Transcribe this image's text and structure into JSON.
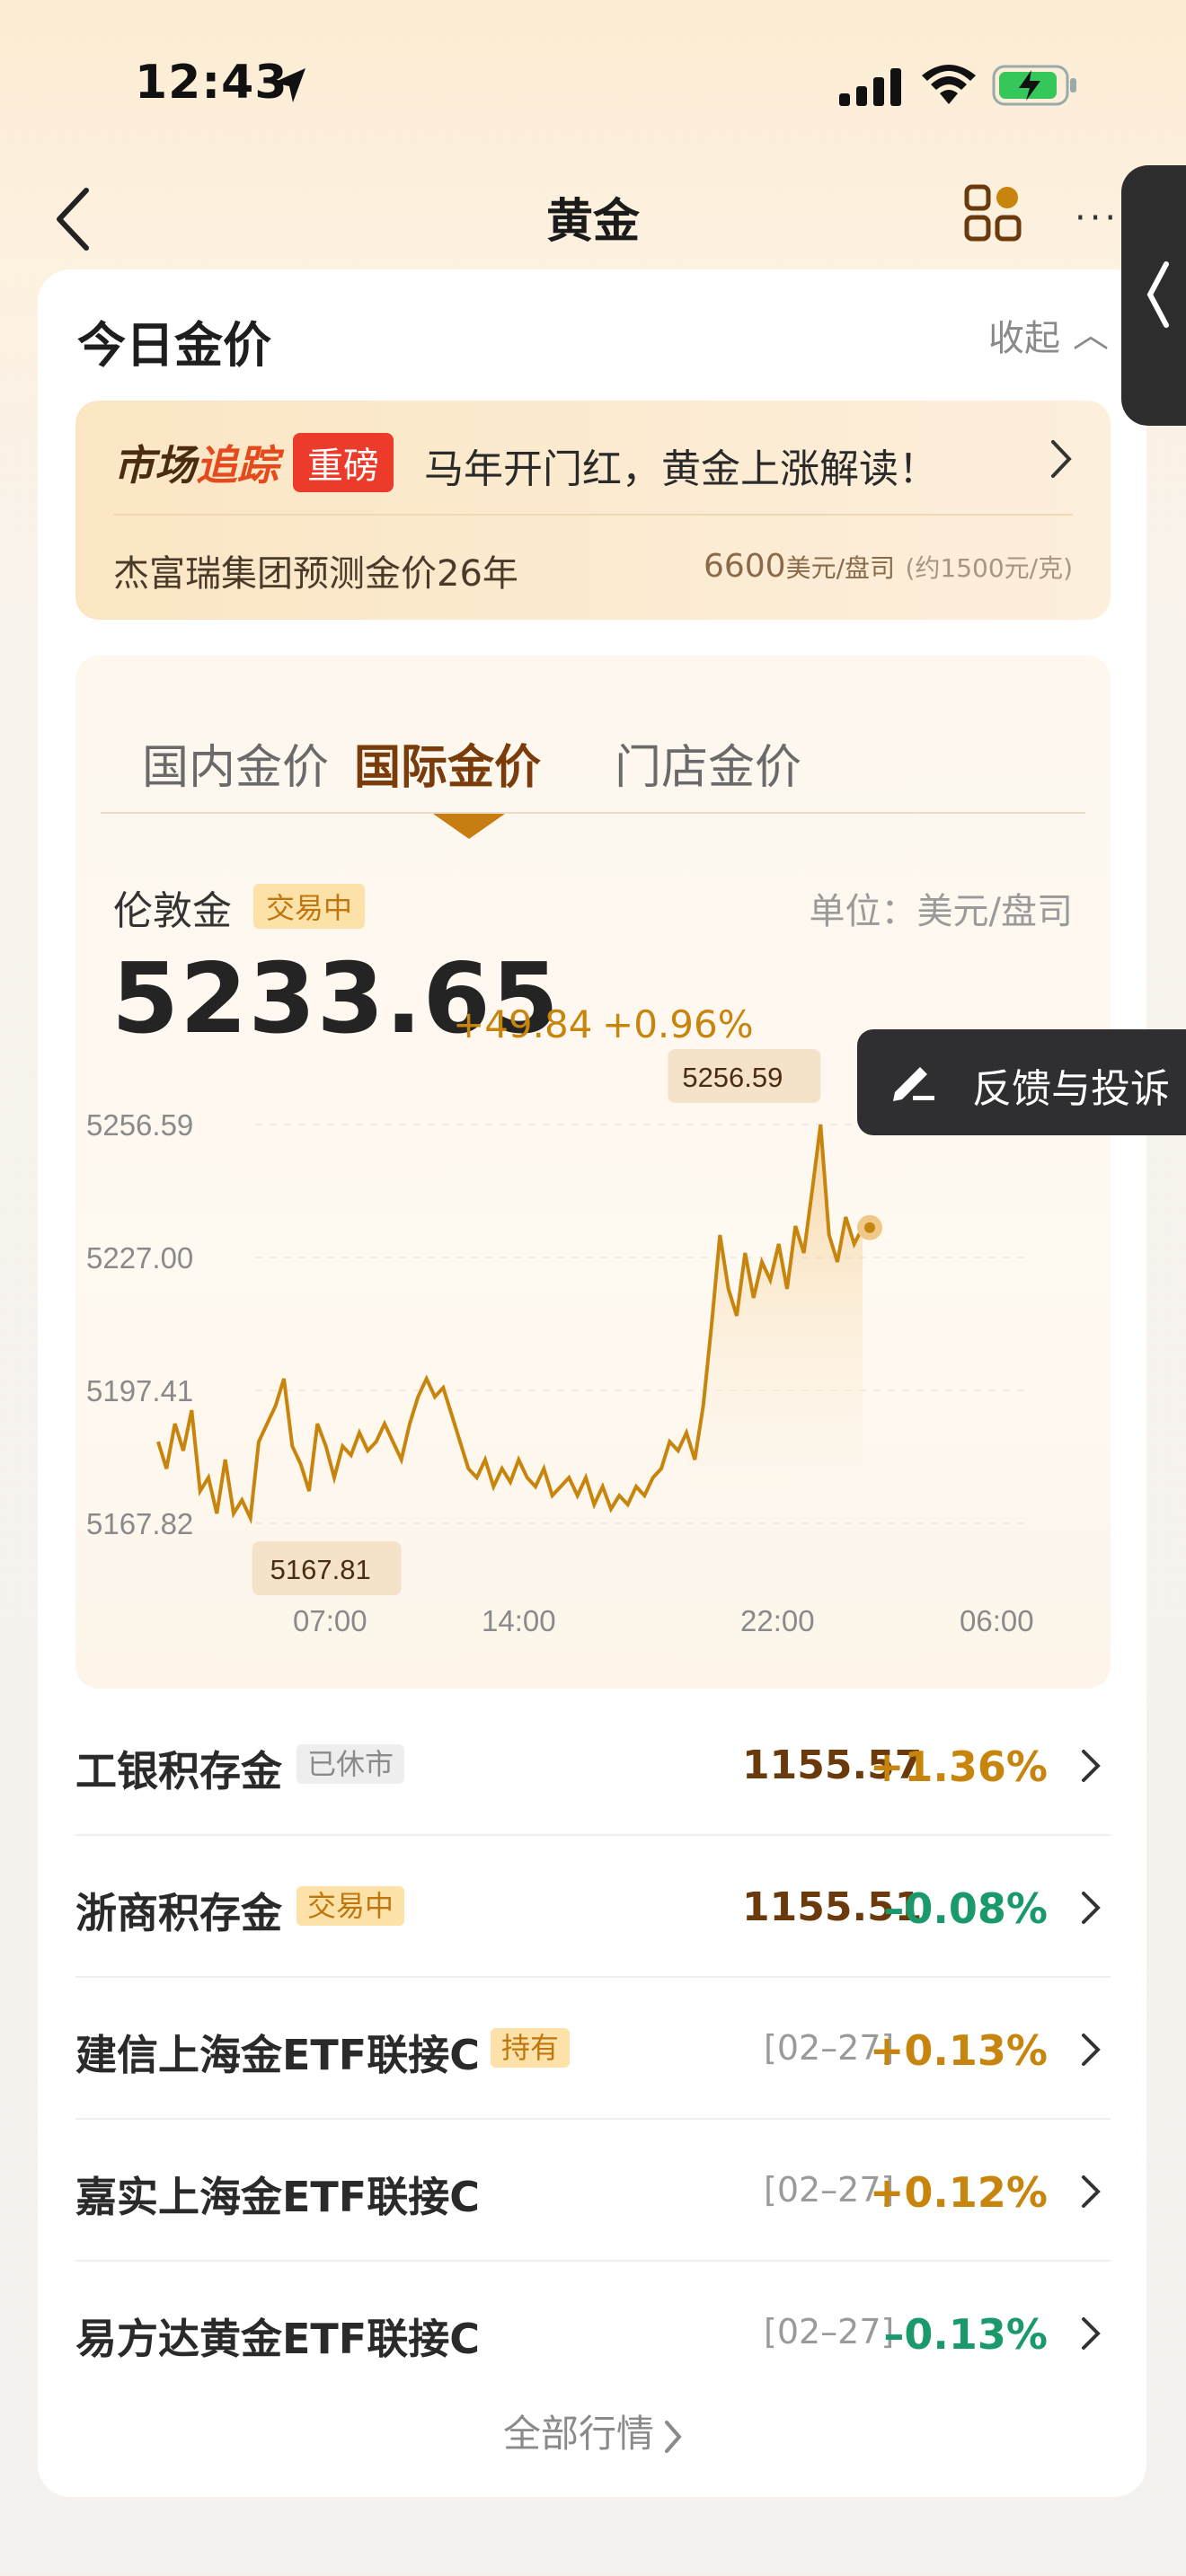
{
  "status_bar": {
    "time": "12:43"
  },
  "nav": {
    "title": "黄金"
  },
  "section": {
    "title": "今日金价",
    "collapse_label": "收起"
  },
  "news": {
    "tag_part1": "市场",
    "tag_part2": "追踪",
    "badge": "重磅",
    "headline": "马年开门红，黄金上涨解读！",
    "sub_left": "杰富瑞集团预测金价26年",
    "sub_right_value": "6600",
    "sub_right_unit": "美元/盘司",
    "sub_right_note": "(约1500元/克)"
  },
  "tabs": [
    {
      "label": "国内金价",
      "active": false
    },
    {
      "label": "国际金价",
      "active": true
    },
    {
      "label": "门店金价",
      "active": false
    }
  ],
  "quote": {
    "market": "伦敦金",
    "status": "交易中",
    "unit": "单位：美元/盘司",
    "price": "5233.65",
    "change": "+49.84",
    "change_pct": "+0.96%"
  },
  "feedback": {
    "label": "反馈与投诉"
  },
  "chart_data": {
    "type": "line",
    "yticks": [
      "5256.59",
      "5227.00",
      "5197.41",
      "5167.82"
    ],
    "ylim": [
      5167.82,
      5256.59
    ],
    "xticks": [
      "07:00",
      "14:00",
      "22:00",
      "06:00"
    ],
    "high_label": "5256.59",
    "low_label": "5167.81",
    "series": [
      {
        "values": [
          5186,
          5180,
          5190,
          5184,
          5193,
          5175,
          5178,
          5170,
          5182,
          5170,
          5173,
          5169,
          5186,
          5190,
          5194,
          5200,
          5185,
          5181,
          5175,
          5190,
          5185,
          5178,
          5185,
          5183,
          5188,
          5184,
          5186,
          5190,
          5186,
          5182,
          5190,
          5196,
          5200,
          5196,
          5198,
          5192,
          5186,
          5180,
          5178,
          5182,
          5176,
          5180,
          5177,
          5182,
          5178,
          5176,
          5180,
          5174,
          5176,
          5178,
          5174,
          5178,
          5172,
          5176,
          5171,
          5174,
          5172,
          5176,
          5174,
          5178,
          5180,
          5186,
          5184,
          5188,
          5182,
          5194,
          5212,
          5232,
          5220,
          5214,
          5228,
          5218,
          5226,
          5222,
          5230,
          5220,
          5234,
          5228,
          5242,
          5256.59,
          5232,
          5226,
          5236,
          5230,
          5233.65
        ]
      }
    ]
  },
  "funds": [
    {
      "name": "工银积存金",
      "tag": "已休市",
      "tag_type": "closed",
      "value": "1155.57",
      "date": "",
      "change": "+1.36%",
      "dir": "up"
    },
    {
      "name": "浙商积存金",
      "tag": "交易中",
      "tag_type": "trading",
      "value": "1155.51",
      "date": "",
      "change": "–0.08%",
      "dir": "down"
    },
    {
      "name": "建信上海金ETF联接C",
      "tag": "持有",
      "tag_type": "hold",
      "value": "",
      "date": "[02–27]",
      "change": "+0.13%",
      "dir": "up"
    },
    {
      "name": "嘉实上海金ETF联接C",
      "tag": "",
      "tag_type": "",
      "value": "",
      "date": "[02–27]",
      "change": "+0.12%",
      "dir": "up"
    },
    {
      "name": "易方达黄金ETF联接C",
      "tag": "",
      "tag_type": "",
      "value": "",
      "date": "[02–27]",
      "change": "–0.13%",
      "dir": "down"
    }
  ],
  "footer": {
    "all_market": "全部行情"
  },
  "colors": {
    "accent": "#c7850e",
    "up": "#c7850e",
    "down": "#1a9a6a",
    "badge_red": "#ec3b2a"
  }
}
